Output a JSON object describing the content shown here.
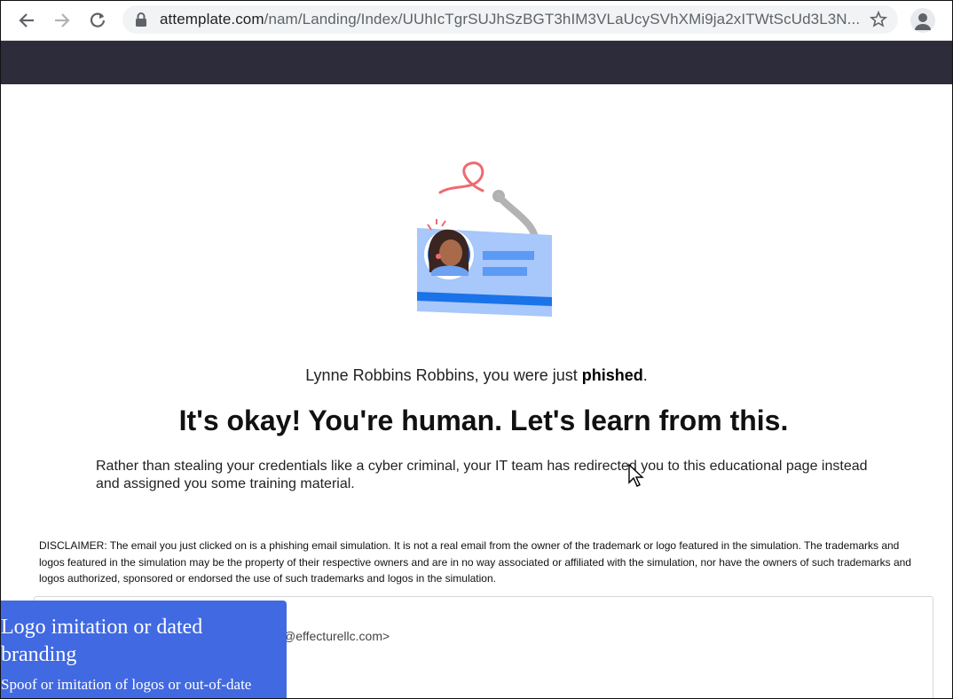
{
  "browser": {
    "url_domain": "attemplate.com",
    "url_path": "/nam/Landing/Index/UUhIcTgrSUJhSzBGT3hIM3VLaUcySVhXMi9ja2xITWtScUd3L3N...",
    "icons": [
      "back-icon",
      "forward-icon",
      "reload-icon",
      "lock-icon",
      "star-icon",
      "profile-icon"
    ]
  },
  "landing": {
    "greeting_prefix": "Lynne Robbins Robbins, you were just ",
    "greeting_bold": "phished",
    "greeting_suffix": ".",
    "headline": "It's okay! You're human. Let's learn from this.",
    "body": "Rather than stealing your credentials like a cyber criminal, your IT team has redirected you to this educational page instead and assigned you some training material.",
    "disclaimer": "DISCLAIMER: The email you just clicked on is a phishing email simulation. It is not a real email from the owner of the trademark or logo featured in the simulation. The trademarks and logos featured in the simulation may be the property of their respective owners and are in no way associated or affiliated with the simulation, nor have the owners of such trademarks and logos authorized, sponsored or endorsed the use of such trademarks and logos in the simulation.",
    "email_from_fragment": "@effecturellc.com>"
  },
  "overlay": {
    "title": "Logo imitation or dated branding",
    "text": "Spoof or imitation of logos or out-of-date"
  },
  "colors": {
    "header_bar": "#2c2c3a",
    "overlay_bg": "#4169e1",
    "card_blue": "#a8c7fa",
    "card_stripe": "#1a73e8",
    "hook_red": "#ee6a70"
  }
}
